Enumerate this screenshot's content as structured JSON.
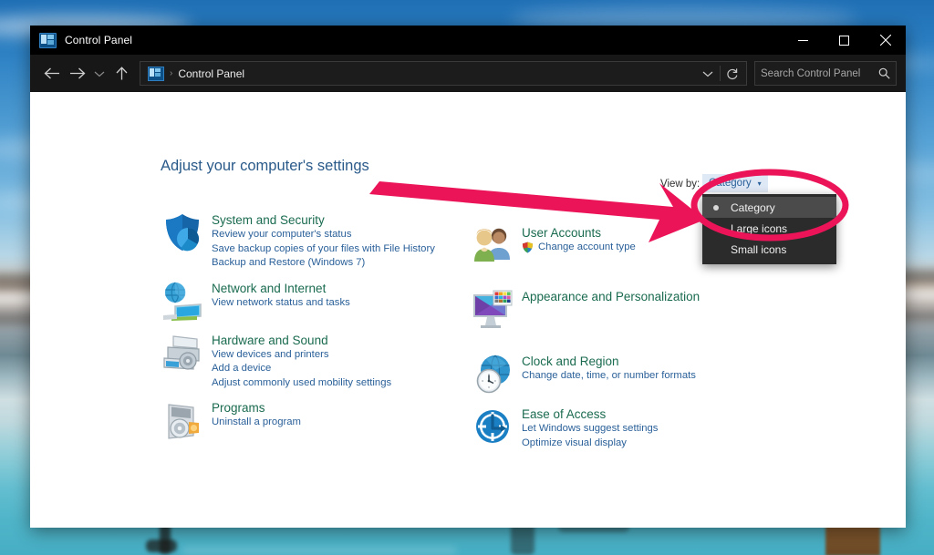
{
  "window": {
    "title": "Control Panel",
    "app_icon": "control-panel-icon",
    "minimize_label": "Minimize",
    "maximize_label": "Maximize",
    "close_label": "Close"
  },
  "nav": {
    "back": "Back",
    "forward": "Forward",
    "recent": "Recent locations",
    "up": "Up",
    "breadcrumb_icon": "control-panel-icon",
    "breadcrumb_separator": "›",
    "breadcrumb_text": "Control Panel",
    "dropdown_label": "Previous locations",
    "refresh_label": "Refresh"
  },
  "search": {
    "placeholder": "Search Control Panel",
    "icon": "search-icon"
  },
  "main": {
    "page_title": "Adjust your computer's settings",
    "view_by_label": "View by:",
    "view_by_value": "Category",
    "view_by_caret": "▾"
  },
  "view_menu": {
    "items": [
      {
        "label": "Category",
        "selected": true
      },
      {
        "label": "Large icons",
        "selected": false
      },
      {
        "label": "Small icons",
        "selected": false
      }
    ]
  },
  "categories": {
    "left": [
      {
        "icon": "shield-security-icon",
        "heading": "System and Security",
        "links": [
          "Review your computer's status",
          "Save backup copies of your files with File History",
          "Backup and Restore (Windows 7)"
        ]
      },
      {
        "icon": "network-globe-monitor-icon",
        "heading": "Network and Internet",
        "links": [
          "View network status and tasks"
        ]
      },
      {
        "icon": "printer-device-icon",
        "heading": "Hardware and Sound",
        "links": [
          "View devices and printers",
          "Add a device",
          "Adjust commonly used mobility settings"
        ]
      },
      {
        "icon": "programs-disc-icon",
        "heading": "Programs",
        "links": [
          "Uninstall a program"
        ]
      }
    ],
    "right": [
      {
        "icon": "user-accounts-people-icon",
        "heading": "User Accounts",
        "links": [
          "Change account type"
        ],
        "link_icons": [
          "uac-shield-icon"
        ]
      },
      {
        "icon": "appearance-monitor-palette-icon",
        "heading": "Appearance and Personalization",
        "links": []
      },
      {
        "icon": "clock-globe-icon",
        "heading": "Clock and Region",
        "links": [
          "Change date, time, or number formats"
        ]
      },
      {
        "icon": "ease-of-access-icon",
        "heading": "Ease of Access",
        "links": [
          "Let Windows suggest settings",
          "Optimize visual display"
        ]
      }
    ]
  },
  "annotation": {
    "type": "highlight-ellipse-with-arrow",
    "color": "#ec1458",
    "target": "Category"
  },
  "colors": {
    "accent_pink": "#ec1458",
    "heading_green": "#1a6b4f",
    "link_blue": "#2a6099",
    "title_blue": "#2a5a8a",
    "titlebar_bg": "#000000",
    "navbar_bg": "#171717",
    "menu_bg": "#2b2b2b",
    "menu_selected_bg": "#4b4b4b",
    "viewby_btn_bg": "#dfe8f5"
  }
}
